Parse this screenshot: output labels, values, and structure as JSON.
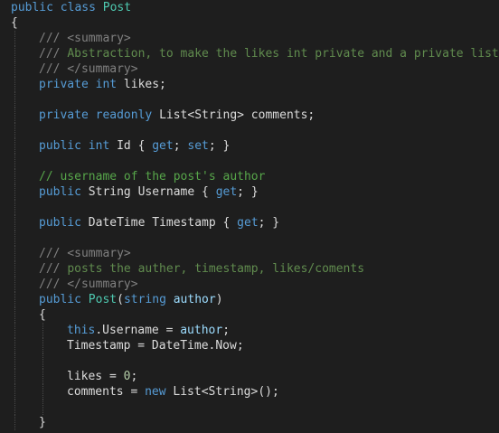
{
  "lines": [
    {
      "indent": 0,
      "tokens": [
        [
          "kw",
          "public class "
        ],
        [
          "ty",
          "Post"
        ]
      ]
    },
    {
      "indent": 0,
      "tokens": [
        [
          "pl",
          "{"
        ]
      ]
    },
    {
      "indent": 1,
      "tokens": [
        [
          "tg",
          "/// <summary>"
        ]
      ]
    },
    {
      "indent": 1,
      "tokens": [
        [
          "tg",
          "/// "
        ],
        [
          "dc",
          "Abstraction, to make the likes int private and a private list."
        ]
      ]
    },
    {
      "indent": 1,
      "tokens": [
        [
          "tg",
          "/// </summary>"
        ]
      ]
    },
    {
      "indent": 1,
      "tokens": [
        [
          "kw",
          "private int "
        ],
        [
          "pl",
          "likes;"
        ]
      ]
    },
    {
      "indent": 1,
      "tokens": []
    },
    {
      "indent": 1,
      "tokens": [
        [
          "kw",
          "private readonly "
        ],
        [
          "pl",
          "List<String> comments;"
        ]
      ]
    },
    {
      "indent": 1,
      "tokens": []
    },
    {
      "indent": 1,
      "tokens": [
        [
          "kw",
          "public int "
        ],
        [
          "pl",
          "Id { "
        ],
        [
          "kw",
          "get"
        ],
        [
          "pl",
          "; "
        ],
        [
          "kw",
          "set"
        ],
        [
          "pl",
          "; }"
        ]
      ]
    },
    {
      "indent": 1,
      "tokens": []
    },
    {
      "indent": 1,
      "tokens": [
        [
          "cm",
          "// username of the post's author"
        ]
      ]
    },
    {
      "indent": 1,
      "tokens": [
        [
          "kw",
          "public "
        ],
        [
          "pl",
          "String Username { "
        ],
        [
          "kw",
          "get"
        ],
        [
          "pl",
          "; }"
        ]
      ]
    },
    {
      "indent": 1,
      "tokens": []
    },
    {
      "indent": 1,
      "tokens": [
        [
          "kw",
          "public "
        ],
        [
          "pl",
          "DateTime Timestamp { "
        ],
        [
          "kw",
          "get"
        ],
        [
          "pl",
          "; }"
        ]
      ]
    },
    {
      "indent": 1,
      "tokens": []
    },
    {
      "indent": 1,
      "tokens": [
        [
          "tg",
          "/// <summary>"
        ]
      ]
    },
    {
      "indent": 1,
      "tokens": [
        [
          "tg",
          "/// "
        ],
        [
          "dc",
          "posts the auther, timestamp, likes/coments"
        ]
      ]
    },
    {
      "indent": 1,
      "tokens": [
        [
          "tg",
          "/// </summary>"
        ]
      ]
    },
    {
      "indent": 1,
      "tokens": [
        [
          "kw",
          "public "
        ],
        [
          "ty",
          "Post"
        ],
        [
          "pl",
          "("
        ],
        [
          "kw",
          "string "
        ],
        [
          "pm",
          "author"
        ],
        [
          "pl",
          ")"
        ]
      ]
    },
    {
      "indent": 1,
      "tokens": [
        [
          "pl",
          "{"
        ]
      ]
    },
    {
      "indent": 2,
      "tokens": [
        [
          "kw",
          "this"
        ],
        [
          "pl",
          ".Username = "
        ],
        [
          "pm",
          "author"
        ],
        [
          "pl",
          ";"
        ]
      ]
    },
    {
      "indent": 2,
      "tokens": [
        [
          "pl",
          "Timestamp = DateTime.Now;"
        ]
      ]
    },
    {
      "indent": 2,
      "tokens": []
    },
    {
      "indent": 2,
      "tokens": [
        [
          "pl",
          "likes = "
        ],
        [
          "nm",
          "0"
        ],
        [
          "pl",
          ";"
        ]
      ]
    },
    {
      "indent": 2,
      "tokens": [
        [
          "pl",
          "comments = "
        ],
        [
          "kw",
          "new "
        ],
        [
          "pl",
          "List<String>();"
        ]
      ]
    },
    {
      "indent": 2,
      "tokens": []
    },
    {
      "indent": 1,
      "tokens": [
        [
          "pl",
          "}"
        ]
      ]
    }
  ],
  "colors": {
    "background": "#1e1e1e",
    "keyword": "#569cd6",
    "type": "#4ec9b0",
    "comment": "#57a64a",
    "doc_comment": "#608b4e",
    "doc_tag": "#808080",
    "parameter": "#9cdcfe",
    "number": "#b5cea8",
    "plain": "#dcdcdc"
  }
}
